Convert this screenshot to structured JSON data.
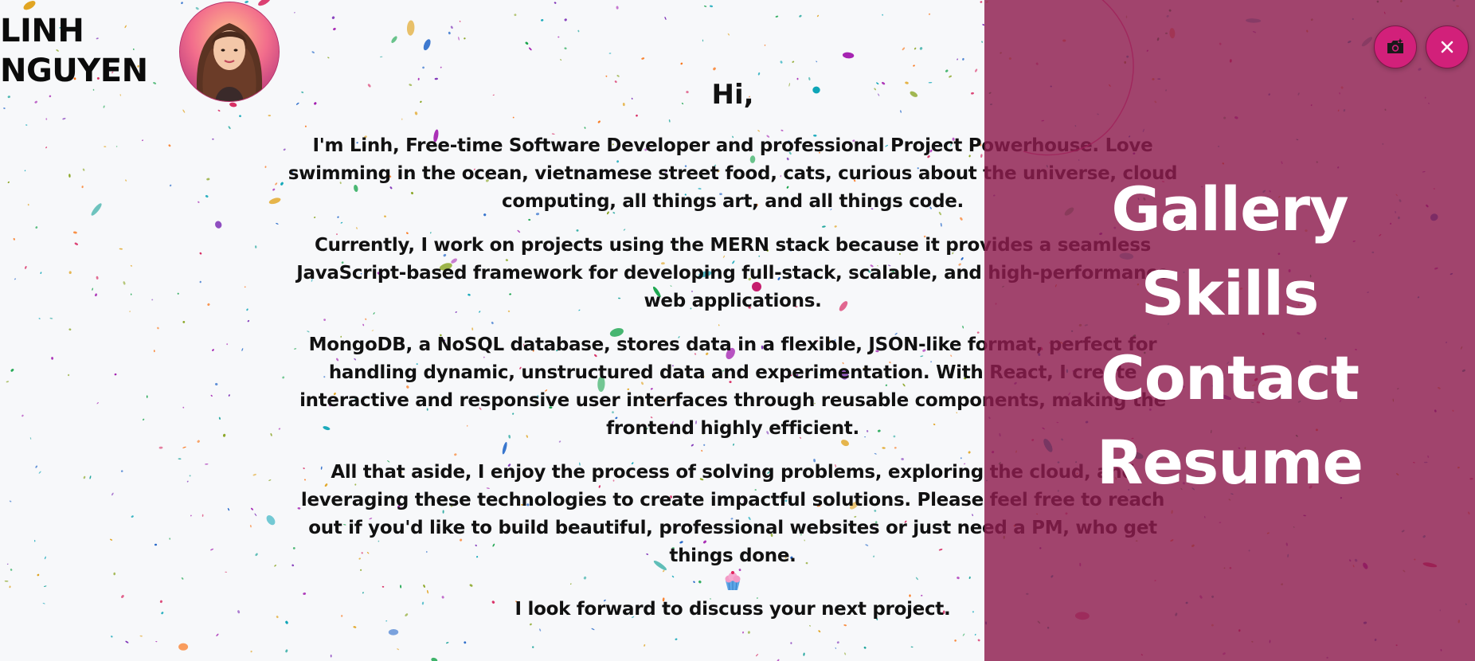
{
  "brand": {
    "first_name": "LINH",
    "last_name": "NGUYEN"
  },
  "avatar": {
    "alt": "Linh Nguyen profile photo"
  },
  "intro": {
    "greeting": "Hi,",
    "paragraphs": [
      "I'm Linh, Free-time Software Developer and professional Project Powerhouse. Love swimming in the ocean, vietnamese street food, cats, curious about the universe, cloud computing, all things art, and all things code.",
      "Currently, I work on projects using the MERN stack because it provides a seamless JavaScript-based framework for developing full-stack, scalable, and high-performance web applications.",
      "MongoDB, a NoSQL database, stores data in a flexible, JSON-like format, perfect for handling dynamic, unstructured data and experimentation. With React, I create interactive and responsive user interfaces through reusable components, making the frontend highly efficient.",
      "All that aside, I enjoy the process of solving problems, exploring the cloud, and leveraging these technologies to create impactful solutions. Please feel free to reach out if you'd like to build beautiful, professional websites or just need a PM, who get things done."
    ],
    "closing": "I look forward to discuss your next project."
  },
  "menu": {
    "items": [
      {
        "label": "Gallery"
      },
      {
        "label": "Skills"
      },
      {
        "label": "Contact"
      },
      {
        "label": "Resume"
      }
    ]
  },
  "controls": {
    "camera_icon": "add-photo-camera-icon",
    "close_icon": "close-icon",
    "close_glyph": "✕"
  },
  "colors": {
    "overlay": "#8e1c4e",
    "button": "#d2207a",
    "background": "#f7f8fa",
    "text": "#111111"
  }
}
